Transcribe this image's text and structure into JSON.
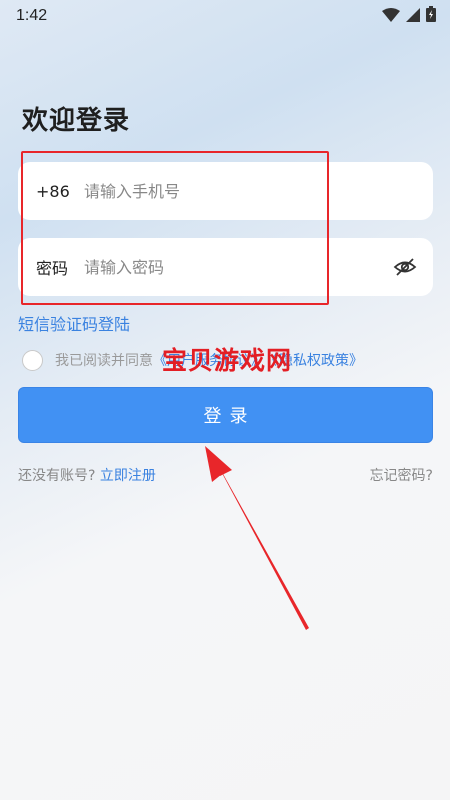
{
  "status_bar": {
    "time": "1:42",
    "icons": [
      "wifi-icon",
      "signal-icon",
      "battery-icon"
    ]
  },
  "title": "欢迎登录",
  "phone_field": {
    "prefix": "+86",
    "placeholder": "请输入手机号"
  },
  "password_field": {
    "label": "密码",
    "placeholder": "请输入密码",
    "toggle_icon": "eye-off-icon"
  },
  "sms_login_link": "短信验证码登陆",
  "agreement": {
    "checked": false,
    "text": "我已阅读并同意",
    "link_1": "《用户服务协议》",
    "link_2": "《隐私权政策》"
  },
  "watermark": "宝贝游戏网",
  "login_button": "登录",
  "register": {
    "prompt": "还没有账号?",
    "link": "立即注册"
  },
  "forgot_password": "忘记密码?",
  "colors": {
    "accent": "#4191f3",
    "link": "#3a82e0",
    "annotation_red": "#e8262a"
  }
}
